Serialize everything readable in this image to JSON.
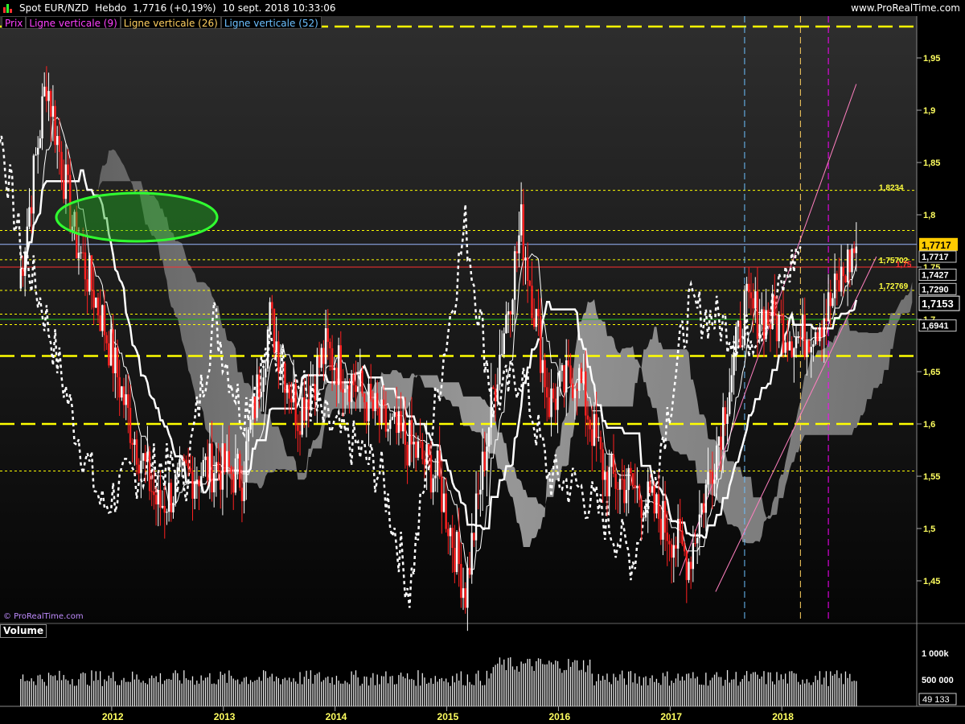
{
  "header": {
    "symbol": "Spot EUR/NZD",
    "timeframe": "Hebdo",
    "quote": "1,7716 (+0,19%)",
    "datetime": "10 sept. 2018 10:33:06",
    "site": "www.ProRealTime.com"
  },
  "legend": {
    "price": "Prix",
    "vline1": "Ligne verticale (9)",
    "vline2": "Ligne verticale (26)",
    "vline3": "Ligne verticale (52)"
  },
  "volume_label": "Volume",
  "copyright": "© ProRealTime.com",
  "colors": {
    "background": "#000000",
    "up_candle": "#ffffff",
    "down_candle": "#ff2020",
    "cloud": "#a0a0a0",
    "level_line": "#ffff00",
    "vline9": "#ff00ff",
    "vline26": "#ffd060",
    "vline52": "#6cc0ff",
    "channel": "#ff80c0",
    "ellipse": "#30ff30",
    "price_tag": "#ffcc00"
  },
  "chart_data": {
    "type": "line",
    "title": "Spot EUR/NZD",
    "xlabel": "",
    "ylabel": "",
    "ylim": [
      1.41,
      1.99
    ],
    "x_ticks": [
      "2012",
      "2013",
      "2014",
      "2015",
      "2016",
      "2017",
      "2018"
    ],
    "y_ticks": [
      "1,95",
      "1,9",
      "1,85",
      "1,8",
      "1,75",
      "1,7",
      "1,65",
      "1,6",
      "1,55",
      "1,5",
      "1,45"
    ],
    "series": [
      {
        "name": "Prix",
        "x": [
          "2011-03",
          "2011-06",
          "2011-09",
          "2011-12",
          "2012-03",
          "2012-06",
          "2012-09",
          "2012-12",
          "2013-03",
          "2013-06",
          "2013-09",
          "2013-12",
          "2014-03",
          "2014-06",
          "2014-09",
          "2014-12",
          "2015-03",
          "2015-06",
          "2015-09",
          "2015-12",
          "2016-03",
          "2016-06",
          "2016-09",
          "2016-12",
          "2017-03",
          "2017-06",
          "2017-09",
          "2017-12",
          "2018-03",
          "2018-06",
          "2018-09"
        ],
        "values": [
          1.73,
          1.93,
          1.78,
          1.7,
          1.6,
          1.52,
          1.55,
          1.56,
          1.55,
          1.7,
          1.61,
          1.67,
          1.64,
          1.6,
          1.58,
          1.55,
          1.44,
          1.63,
          1.79,
          1.62,
          1.65,
          1.55,
          1.54,
          1.51,
          1.47,
          1.58,
          1.71,
          1.7,
          1.68,
          1.71,
          1.7716
        ]
      }
    ],
    "annotations": {
      "levels": [
        {
          "label": "1,8234",
          "value": 1.8234
        },
        {
          "label": "1,75702",
          "value": 1.75702
        },
        {
          "label": "1,75",
          "value": 1.75
        },
        {
          "label": "1,72769",
          "value": 1.72769
        }
      ],
      "dashed_levels": [
        1.98,
        1.665,
        1.6
      ],
      "right_labels": [
        {
          "label": "1,7717",
          "value": 1.7717
        },
        {
          "label": "1,7717",
          "value": 1.76
        },
        {
          "label": "1,7427",
          "value": 1.7427
        },
        {
          "label": "1,7290",
          "value": 1.729
        },
        {
          "label": "1,7153",
          "value": 1.7153
        },
        {
          "label": "1,6941",
          "value": 1.6941
        }
      ],
      "vertical_lines": [
        {
          "name": "Ligne verticale (52)",
          "x": "2017-09"
        },
        {
          "name": "Ligne verticale (26)",
          "x": "2018-03"
        },
        {
          "name": "Ligne verticale (9)",
          "x": "2018-06"
        }
      ]
    },
    "volume": {
      "ylim": [
        0,
        1300000
      ],
      "y_ticks": [
        "1 000k",
        "500 000"
      ],
      "last_label": "49 133"
    }
  }
}
